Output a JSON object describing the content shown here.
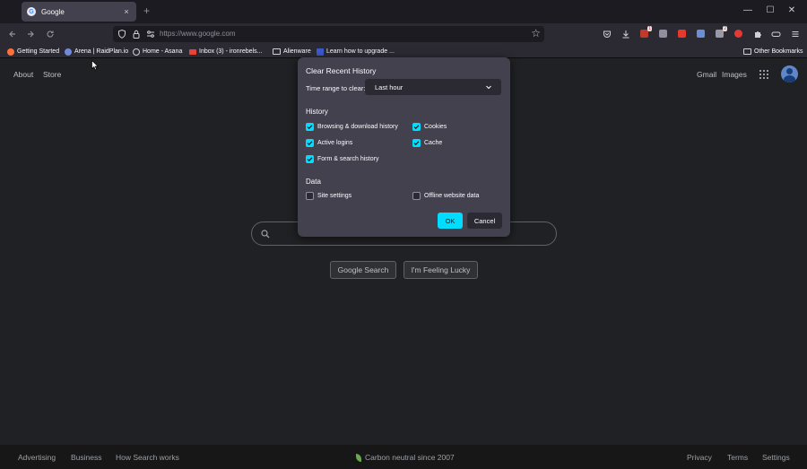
{
  "browser": {
    "tab": {
      "title": "Google",
      "favicon": "G",
      "close": "×"
    },
    "new_tab": "+",
    "window_controls": {
      "minimize": "—",
      "maximize": "☐",
      "close": "✕"
    },
    "url": "https://www.google.com",
    "accent": "#00ddff"
  },
  "bookmarks": {
    "items": [
      {
        "label": "Getting Started",
        "color": "#ff7139"
      },
      {
        "label": "Arena | RaidPlan.io",
        "color": "#7289da"
      },
      {
        "label": "Home - Asana",
        "color": "#cfcfd8"
      },
      {
        "label": "Inbox (3) - ironrebels...",
        "color": "#ea4335"
      },
      {
        "label": "Alienware",
        "color": ""
      },
      {
        "label": "Learn how to upgrade ...",
        "color": "#3c5acf"
      }
    ],
    "other": "Other Bookmarks"
  },
  "google": {
    "top_left": {
      "about": "About",
      "store": "Store"
    },
    "top_right": {
      "gmail": "Gmail",
      "images": "Images"
    },
    "search_button": "Google Search",
    "lucky_button": "I'm Feeling Lucky",
    "footer": {
      "advertising": "Advertising",
      "business": "Business",
      "how_search_works": "How Search works",
      "carbon": "Carbon neutral since 2007",
      "privacy": "Privacy",
      "terms": "Terms",
      "settings": "Settings"
    }
  },
  "dialog": {
    "title": "Clear Recent History",
    "time_range_label": "Time range to clear:",
    "time_range_value": "Last hour",
    "history_heading": "History",
    "history": {
      "browsing": {
        "label": "Browsing & download history",
        "checked": true
      },
      "cookies": {
        "label": "Cookies",
        "checked": true
      },
      "logins": {
        "label": "Active logins",
        "checked": true
      },
      "cache": {
        "label": "Cache",
        "checked": true
      },
      "forms": {
        "label": "Form & search history",
        "checked": true
      }
    },
    "data_heading": "Data",
    "data": {
      "site_settings": {
        "label": "Site settings",
        "checked": false
      },
      "offline": {
        "label": "Offline website data",
        "checked": false
      }
    },
    "ok": "OK",
    "cancel": "Cancel"
  }
}
